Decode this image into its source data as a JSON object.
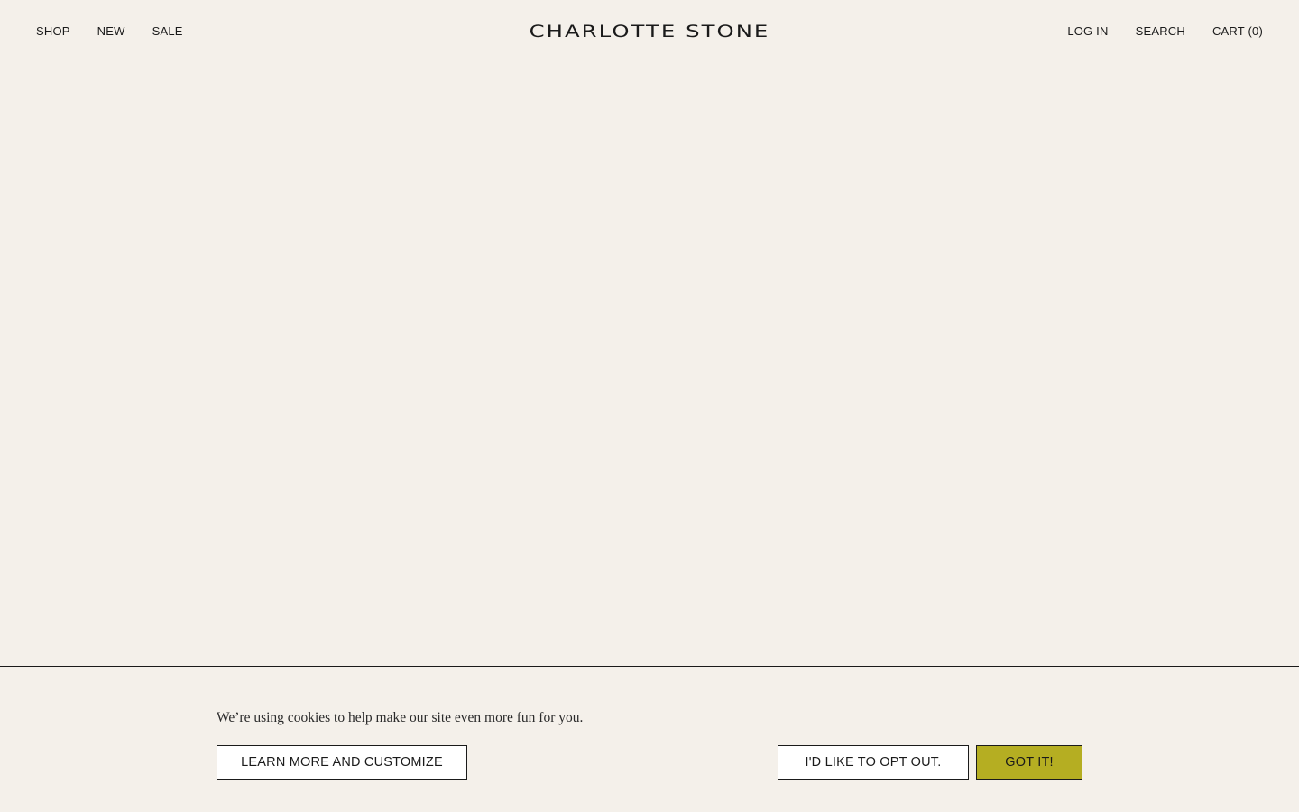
{
  "header": {
    "nav_left": [
      "SHOP",
      "NEW",
      "SALE"
    ],
    "logo": "CHARLOTTE STONE",
    "nav_right": {
      "login": "LOG IN",
      "search": "SEARCH",
      "cart": "CART (0)"
    }
  },
  "cookie_banner": {
    "message": "We’re using cookies to help make our site even more fun for you.",
    "learn_more_label": "LEARN MORE AND CUSTOMIZE",
    "opt_out_label": "I'D LIKE TO OPT OUT.",
    "accept_label": "GOT IT!"
  },
  "colors": {
    "background": "#f4f0ea",
    "text": "#1a1a1a",
    "accept_button": "#b5ae22"
  }
}
